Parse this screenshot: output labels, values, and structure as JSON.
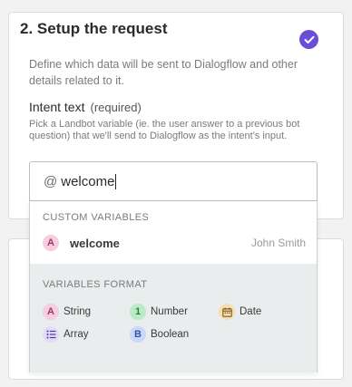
{
  "step": {
    "title": "2. Setup the request",
    "description": "Define which data will be sent to Dialogflow and other details related to it.",
    "completed_color": "#6a4fd6"
  },
  "field": {
    "label": "Intent text",
    "required": "(required)",
    "help": "Pick a Landbot variable (ie. the user answer to a previous bot question) that we'll send to Dialogflow as the intent's input.",
    "prefix": "@",
    "value": "welcome"
  },
  "dropdown": {
    "custom_header": "CUSTOM VARIABLES",
    "items": [
      {
        "badge": "A",
        "type": "string",
        "name": "welcome",
        "owner": "John Smith"
      }
    ],
    "format_header": "VARIABLES FORMAT",
    "formats": [
      {
        "badge": "A",
        "label": "String",
        "icon": "string-badge-icon"
      },
      {
        "badge": "1",
        "label": "Number",
        "icon": "number-badge-icon"
      },
      {
        "badge": "",
        "label": "Date",
        "icon": "calendar-icon"
      },
      {
        "badge": "",
        "label": "Array",
        "icon": "list-icon"
      },
      {
        "badge": "B",
        "label": "Boolean",
        "icon": "boolean-badge-icon"
      }
    ]
  }
}
